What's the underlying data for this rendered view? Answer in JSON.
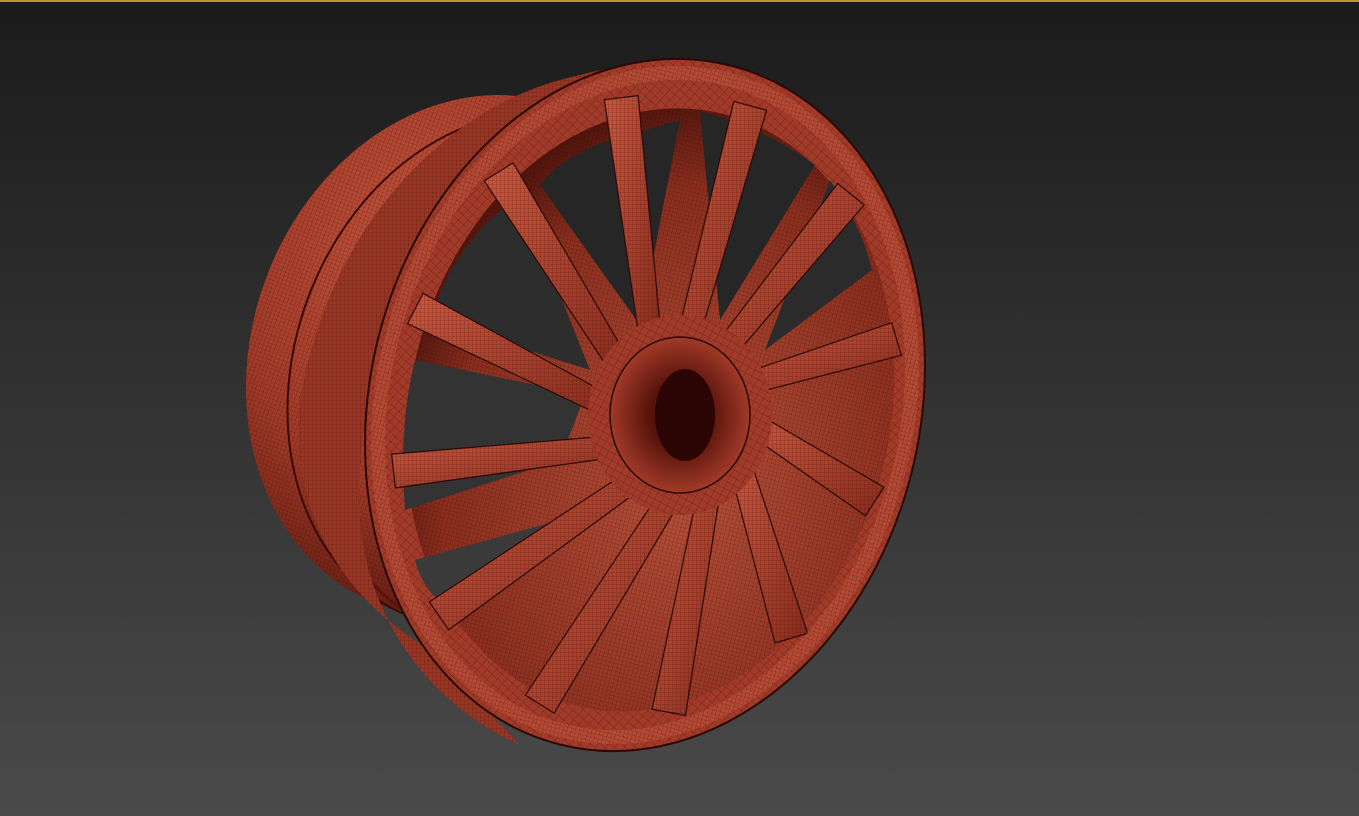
{
  "viewport": {
    "background_top_color": "#1b1b1b",
    "background_bottom_color": "#4a4a4a",
    "active_border_color": "#b8952e",
    "shading_mode": "edged-faces"
  },
  "model": {
    "object": "alloy-wheel-rim",
    "spoke_count": 12,
    "base_color": "#a13a28",
    "highlight_color": "#c9583f",
    "shadow_color": "#4a0e08",
    "hub_hole_color": "#2a0503",
    "wire_color": "#2b0906"
  }
}
